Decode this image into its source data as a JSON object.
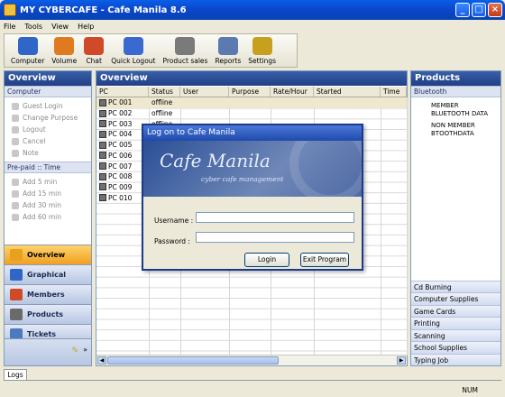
{
  "window": {
    "title": "MY CYBERCAFE - Cafe Manila 8.6"
  },
  "menu": [
    "File",
    "Tools",
    "View",
    "Help"
  ],
  "toolbar": [
    {
      "label": "Computer",
      "icon": "monitor-icon",
      "color": "#2f66c8"
    },
    {
      "label": "Volume",
      "icon": "person-icon",
      "color": "#e07a20"
    },
    {
      "label": "Chat",
      "icon": "chat-icon",
      "color": "#d04a2a"
    },
    {
      "label": "Quick Logout",
      "icon": "logout-icon",
      "color": "#3a6ad0"
    },
    {
      "label": "Product sales",
      "icon": "cart-icon",
      "color": "#7a7a7a"
    },
    {
      "label": "Reports",
      "icon": "printer-icon",
      "color": "#5a7ab0"
    },
    {
      "label": "Settings",
      "icon": "database-icon",
      "color": "#c8a020"
    }
  ],
  "left": {
    "title": "Overview",
    "section1": "Computer",
    "computer_items": [
      "Guest Login",
      "Change Purpose",
      "Logout",
      "Cancel",
      "Note"
    ],
    "section2": "Pre-paid :: Time",
    "time_items": [
      "Add 5 min",
      "Add 15 min",
      "Add 30 min",
      "Add 60 min"
    ],
    "nav": [
      {
        "label": "Overview",
        "active": true,
        "color": "#e8a020"
      },
      {
        "label": "Graphical",
        "active": false,
        "color": "#2f66c8"
      },
      {
        "label": "Members",
        "active": false,
        "color": "#d04a2a"
      },
      {
        "label": "Products",
        "active": false,
        "color": "#6a6a6a"
      },
      {
        "label": "Tickets",
        "active": false,
        "color": "#4a7ac0"
      }
    ]
  },
  "main": {
    "title": "Overview",
    "columns": [
      "PC",
      "Status",
      "User",
      "Purpose",
      "Rate/Hour",
      "Started",
      "Time"
    ],
    "rows": [
      {
        "pc": "PC 001",
        "status": "offline"
      },
      {
        "pc": "PC 002",
        "status": "offline"
      },
      {
        "pc": "PC 003",
        "status": "offline"
      },
      {
        "pc": "PC 004",
        "status": ""
      },
      {
        "pc": "PC 005",
        "status": ""
      },
      {
        "pc": "PC 006",
        "status": ""
      },
      {
        "pc": "PC 007",
        "status": ""
      },
      {
        "pc": "PC 008",
        "status": ""
      },
      {
        "pc": "PC 009",
        "status": ""
      },
      {
        "pc": "PC 010",
        "status": ""
      }
    ]
  },
  "right": {
    "title": "Products",
    "section": "Bluetooth",
    "products": [
      "MEMBER",
      "BLUETOOTH DATA",
      "NON MEMBER",
      "BTOOTHDATA"
    ],
    "categories": [
      "Cd Burning",
      "Computer Supplies",
      "Game Cards",
      "Printing",
      "Scanning",
      "School Supplies",
      "Typing Job"
    ]
  },
  "dialog": {
    "title": "Log on to Cafe Manila",
    "banner_title": "Cafe Manila",
    "banner_sub": "cyber cafe management",
    "username_label": "Username :",
    "password_label": "Password :",
    "login_label": "Login",
    "exit_label": "Exit Program"
  },
  "bottom": {
    "tab": "Logs",
    "num": "NUM"
  }
}
